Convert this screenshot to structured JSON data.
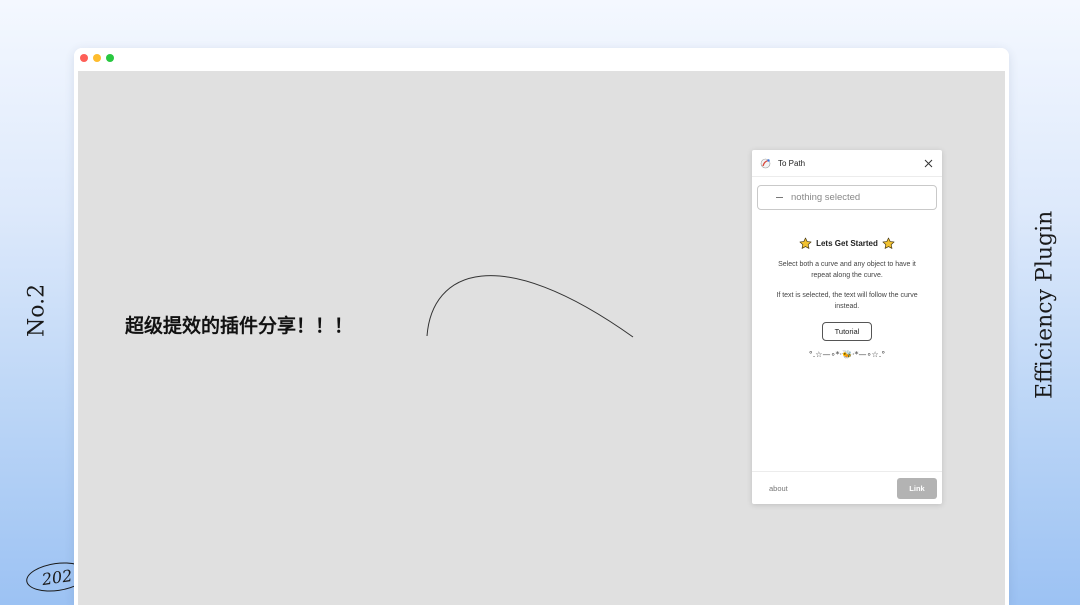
{
  "slide": {
    "left_label": "No.2",
    "right_label": "Efficiency Plugin",
    "year_badge": "202"
  },
  "canvas": {
    "headline": "超级提效的插件分享！！！"
  },
  "plugin": {
    "title": "To Path",
    "selection_status": "nothing selected",
    "get_started_title": "Lets Get Started",
    "description_1": "Select both a curve and any object to have it repeat along the curve.",
    "description_2": "If text is selected, the text will follow the curve instead.",
    "tutorial_label": "Tutorial",
    "decoration": "°.☆—∘*·🐝·*—∘☆.°",
    "about_label": "about",
    "link_label": "Link"
  },
  "colors": {
    "traffic_red": "#fe5f57",
    "traffic_yellow": "#febc2e",
    "traffic_green": "#28c840",
    "canvas_bg": "#e0e0e0",
    "link_button_disabled": "#b3b3b3",
    "star_fill": "#f2c230"
  },
  "icons": {
    "plugin": "plugin-logo-icon",
    "close": "close-icon",
    "selection": "dash-icon",
    "star": "star-icon"
  }
}
